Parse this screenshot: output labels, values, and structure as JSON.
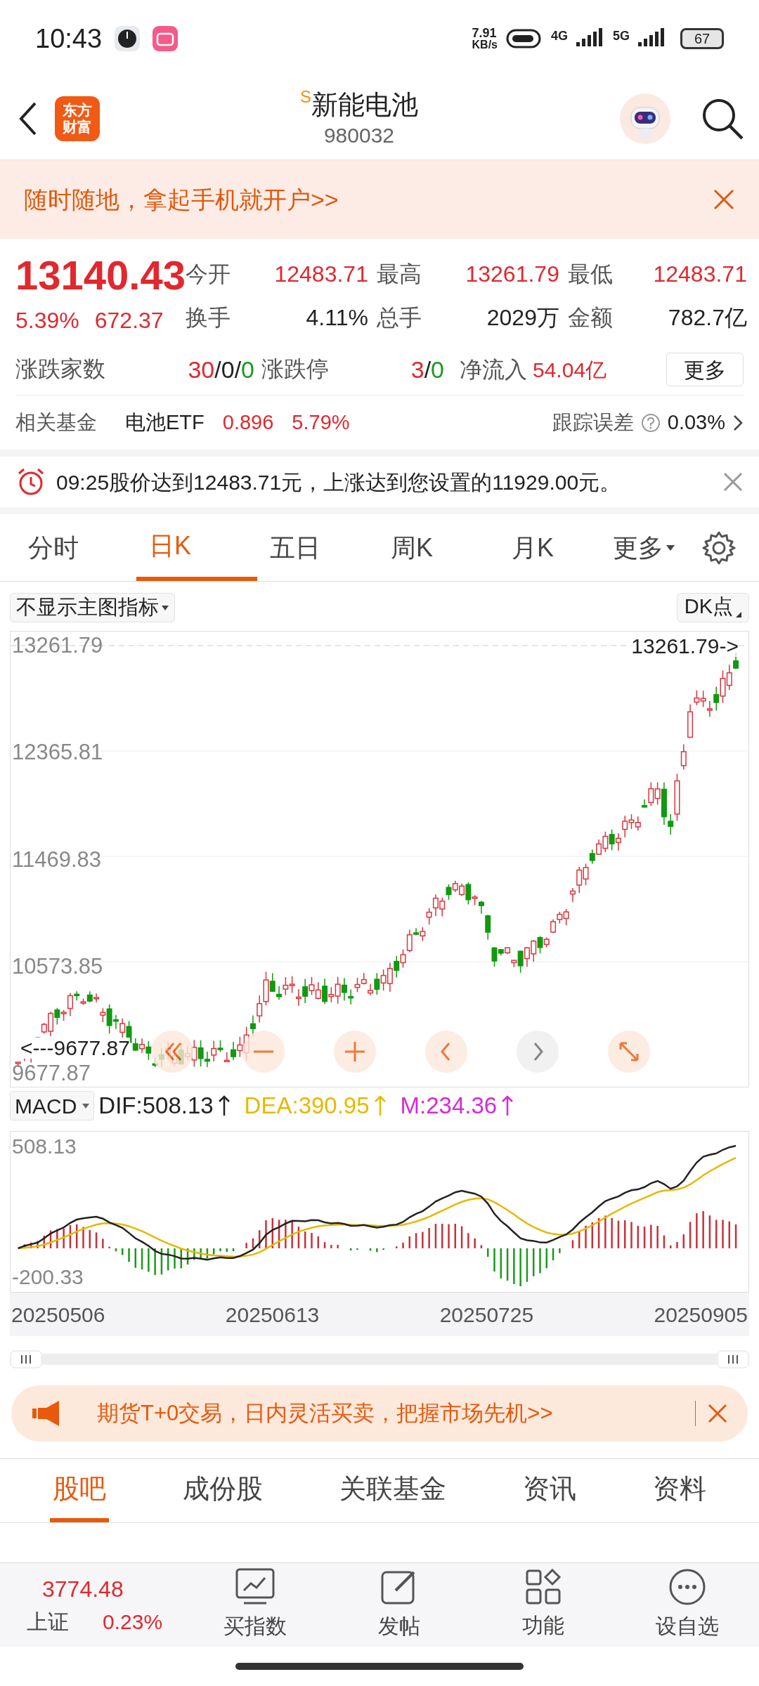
{
  "status_bar": {
    "time": "10:43",
    "net_speed": "7.91",
    "net_unit": "KB/s",
    "signal_a": "4G",
    "signal_b": "5G",
    "battery": "67"
  },
  "header": {
    "logo_top": "东方",
    "logo_bottom": "财富",
    "title_mark": "S",
    "title": "新能电池",
    "code": "980032"
  },
  "banner": {
    "text": "随时随地，拿起手机就开户>>"
  },
  "quote": {
    "price": "13140.43",
    "change_pct": "5.39%",
    "change": "672.37",
    "stats": [
      {
        "label": "今开",
        "value": "12483.71",
        "color": "#e0282e"
      },
      {
        "label": "最高",
        "value": "13261.79",
        "color": "#e0282e"
      },
      {
        "label": "最低",
        "value": "12483.71",
        "color": "#e0282e"
      },
      {
        "label": "换手",
        "value": "4.11%",
        "color": "#222222"
      },
      {
        "label": "总手",
        "value": "2029万",
        "color": "#222222"
      },
      {
        "label": "金额",
        "value": "782.7亿",
        "color": "#222222"
      }
    ],
    "breadth": {
      "label": "涨跌家数",
      "parts": [
        {
          "text": "30",
          "color": "#e0282e"
        },
        {
          "text": "/",
          "color": "#222222"
        },
        {
          "text": "0",
          "color": "#222222"
        },
        {
          "text": "/",
          "color": "#222222"
        },
        {
          "text": "0",
          "color": "#1d9a1d"
        }
      ]
    },
    "limit": {
      "label": "涨跌停",
      "parts": [
        {
          "text": "3",
          "color": "#e0282e"
        },
        {
          "text": "/",
          "color": "#222222"
        },
        {
          "text": "0",
          "color": "#1d9a1d"
        }
      ]
    },
    "inflow": {
      "label": "净流入",
      "value": "54.04亿",
      "color": "#e0282e"
    },
    "more_button": "更多"
  },
  "fund": {
    "label": "相关基金",
    "name": "电池ETF",
    "price": "0.896",
    "pct": "5.79%",
    "tracking_label": "跟踪误差",
    "tracking": "0.03%"
  },
  "alert": {
    "text": "09:25股价达到12483.71元，上涨达到您设置的11929.00元。"
  },
  "chart_tabs": [
    {
      "label": "分时",
      "selected": false
    },
    {
      "label": "日K",
      "selected": true
    },
    {
      "label": "五日",
      "selected": false
    },
    {
      "label": "周K",
      "selected": false
    },
    {
      "label": "月K",
      "selected": false
    }
  ],
  "chart_more": "更多",
  "kline": {
    "indicator": "不显示主图指标",
    "dk": "DK点",
    "yticks": [
      "13261.79",
      "12365.81",
      "11469.83",
      "10573.85",
      "9677.87"
    ],
    "high_marker": "13261.79->",
    "low_marker": "<---9677.87",
    "controls": [
      {
        "kind": "rewind",
        "disabled": false
      },
      {
        "kind": "zoom_out",
        "disabled": false
      },
      {
        "kind": "zoom_in",
        "disabled": false
      },
      {
        "kind": "prev",
        "disabled": false
      },
      {
        "kind": "next",
        "disabled": true
      },
      {
        "kind": "expand",
        "disabled": false
      }
    ]
  },
  "macd": {
    "label": "MACD",
    "dif": "DIF:508.13",
    "dea": "DEA:390.95",
    "m": "M:234.36",
    "yticks": [
      "508.13",
      "-200.33"
    ],
    "dates": [
      "20250506",
      "20250613",
      "20250725",
      "20250905"
    ]
  },
  "ad": {
    "text": "期货T+0交易，日内灵活买卖，把握市场先机>>"
  },
  "section_tabs": [
    {
      "label": "股吧",
      "selected": true
    },
    {
      "label": "成份股",
      "selected": false
    },
    {
      "label": "关联基金",
      "selected": false
    },
    {
      "label": "资讯",
      "selected": false
    },
    {
      "label": "资料",
      "selected": false
    }
  ],
  "bottom_nav": {
    "index": {
      "value": "3774.48",
      "name": "上证",
      "pct": "0.23%"
    },
    "items": [
      {
        "kind": "chart",
        "label": "买指数"
      },
      {
        "kind": "edit",
        "label": "发帖"
      },
      {
        "kind": "apps",
        "label": "功能"
      },
      {
        "kind": "more",
        "label": "设自选"
      }
    ]
  }
}
